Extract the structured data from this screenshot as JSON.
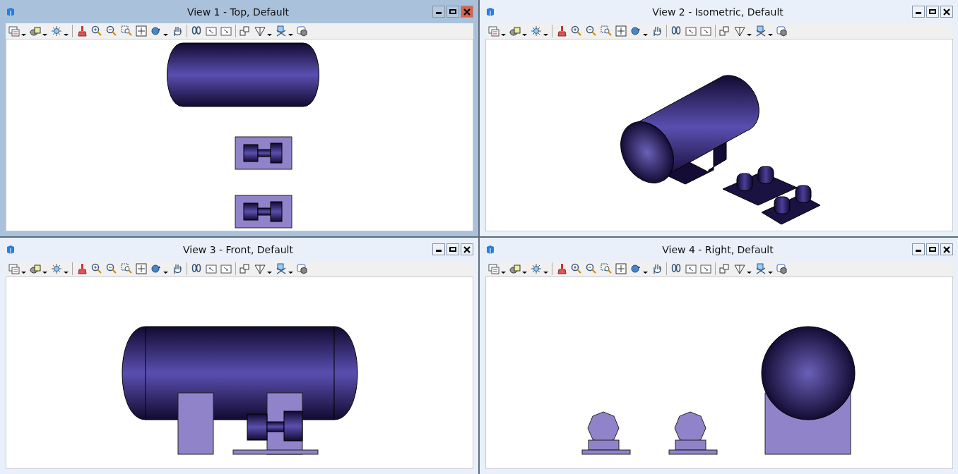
{
  "views": [
    {
      "title": "View 1 - Top, Default",
      "active": true,
      "kind": "top"
    },
    {
      "title": "View 2 - Isometric, Default",
      "active": false,
      "kind": "isometric"
    },
    {
      "title": "View 3 - Front, Default",
      "active": false,
      "kind": "front"
    },
    {
      "title": "View 4 - Right, Default",
      "active": false,
      "kind": "right"
    }
  ]
}
